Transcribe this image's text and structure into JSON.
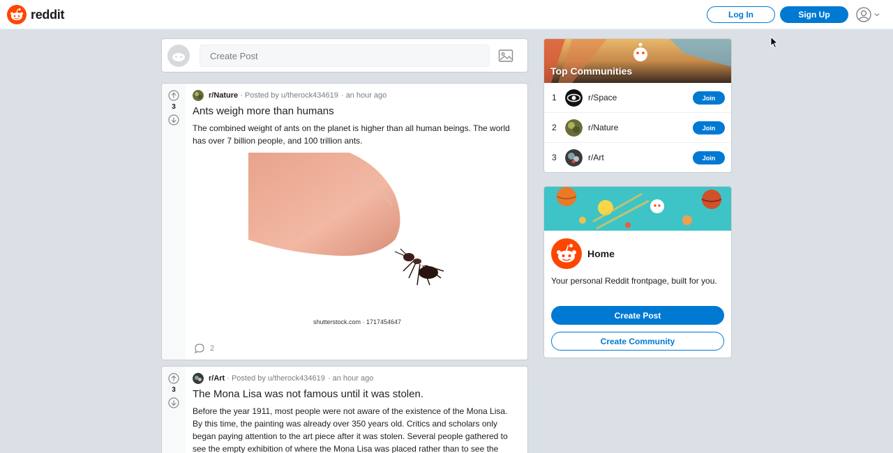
{
  "header": {
    "logo_text": "reddit",
    "login_label": "Log In",
    "signup_label": "Sign Up"
  },
  "create_post": {
    "placeholder": "Create Post"
  },
  "posts": [
    {
      "subreddit": "r/Nature",
      "posted_by": "· Posted by u/therock434619",
      "time": "· an hour ago",
      "votes": "3",
      "title": "Ants weigh more than humans",
      "text": "The combined weight of ants on the planet is higher than all human beings. The world has over 7 billion people, and 100 trillion ants.",
      "image_caption": "shutterstock.com · 1717454647",
      "comments": "2"
    },
    {
      "subreddit": "r/Art",
      "posted_by": "· Posted by u/therock434619",
      "time": "· an hour ago",
      "votes": "3",
      "title": "The Mona Lisa was not famous until it was stolen.",
      "text": "Before the year 1911, most people were not aware of the existence of the Mona Lisa. By this time, the painting was already over 350 years old. Critics and scholars only began paying attention to the art piece after it was stolen. Several people gathered to see the empty exhibition of where the Mona Lisa was placed rather than to see the"
    }
  ],
  "top_communities": {
    "title": "Top Communities",
    "items": [
      {
        "rank": "1",
        "name": "r/Space",
        "join": "Join"
      },
      {
        "rank": "2",
        "name": "r/Nature",
        "join": "Join"
      },
      {
        "rank": "3",
        "name": "r/Art",
        "join": "Join"
      }
    ]
  },
  "home_card": {
    "title": "Home",
    "description": "Your personal Reddit frontpage, built for you.",
    "create_post_label": "Create Post",
    "create_community_label": "Create Community"
  },
  "colors": {
    "accent": "#0079d3",
    "brand": "#ff4500",
    "background": "#dae0e6"
  }
}
